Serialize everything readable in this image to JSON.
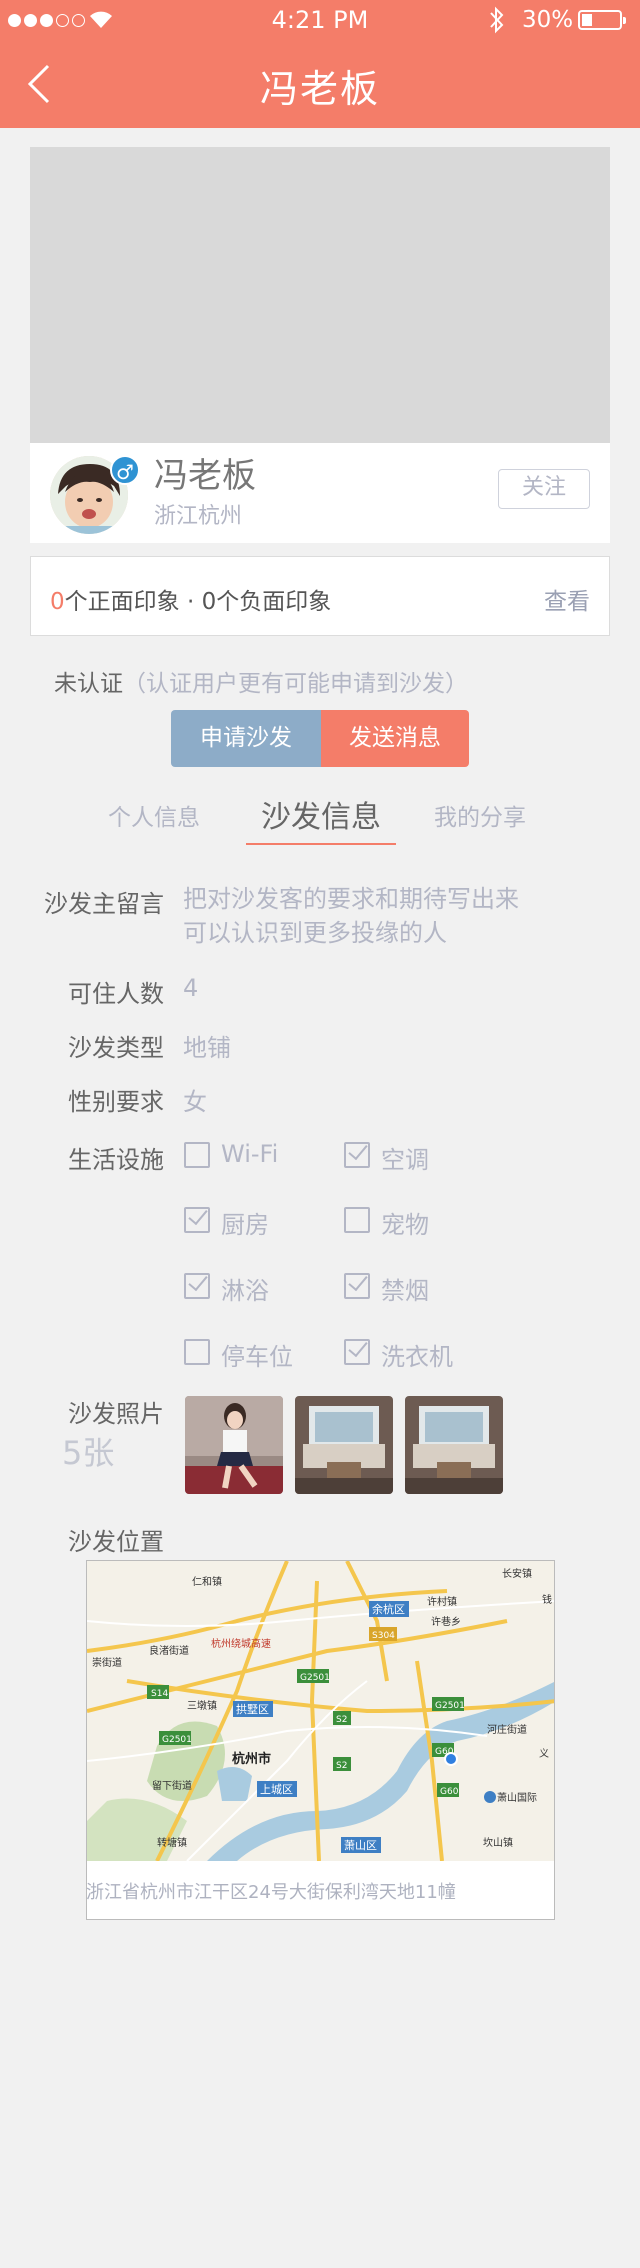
{
  "status_bar": {
    "time": "4:21 PM",
    "battery": "30%"
  },
  "nav": {
    "title": "冯老板"
  },
  "profile": {
    "name": "冯老板",
    "location": "浙江杭州",
    "gender_symbol": "♂",
    "follow_label": "关注"
  },
  "impressions": {
    "positive_count": "0",
    "text": "个正面印象 · 0个负面印象",
    "view_label": "查看"
  },
  "certification": {
    "status": "未认证",
    "hint": "（认证用户更有可能申请到沙发）"
  },
  "actions": {
    "apply": "申请沙发",
    "message": "发送消息"
  },
  "tabs": [
    {
      "label": "个人信息",
      "active": false
    },
    {
      "label": "沙发信息",
      "active": true
    },
    {
      "label": "我的分享",
      "active": false
    }
  ],
  "sofa_info": {
    "message_label": "沙发主留言",
    "message_lines": [
      "把对沙发客的要求和期待写出来",
      "可以认识到更多投缘的人"
    ],
    "capacity_label": "可住人数",
    "capacity": "4",
    "type_label": "沙发类型",
    "type": "地铺",
    "gender_label": "性别要求",
    "gender": "女",
    "facilities_label": "生活设施",
    "facilities": [
      {
        "name": "Wi-Fi",
        "checked": false
      },
      {
        "name": "空调",
        "checked": true
      },
      {
        "name": "厨房",
        "checked": true
      },
      {
        "name": "宠物",
        "checked": false
      },
      {
        "name": "淋浴",
        "checked": true
      },
      {
        "name": "禁烟",
        "checked": true
      },
      {
        "name": "停车位",
        "checked": false
      },
      {
        "name": "洗衣机",
        "checked": true
      }
    ],
    "photos_label": "沙发照片",
    "photos_count": "5张",
    "location_label": "沙发位置",
    "address": "浙江省杭州市江干区24号大街保利湾天地11幢"
  },
  "map": {
    "labels": {
      "renhe": "仁和镇",
      "yuhang": "余杭区",
      "xucun": "许村镇",
      "xuxiang": "许巷乡",
      "changan": "长安镇",
      "liangzhu": "良渚街道",
      "huanghu": "杭州绕城高速",
      "laidian": "崇街道",
      "sandun": "三墩镇",
      "gongshu": "拱墅区",
      "hangzhou": "杭州市",
      "shangcheng": "上城区",
      "xiaoshan": "萧山区",
      "liuxia": "留下街道",
      "zhuantang": "转塘镇",
      "kanshan": "坎山镇",
      "hezhuang": "河庄街道",
      "airport": "萧山国际",
      "yi": "义",
      "qian": "钱"
    },
    "roads": [
      "G2501",
      "S304",
      "S14",
      "S2",
      "G60"
    ]
  }
}
